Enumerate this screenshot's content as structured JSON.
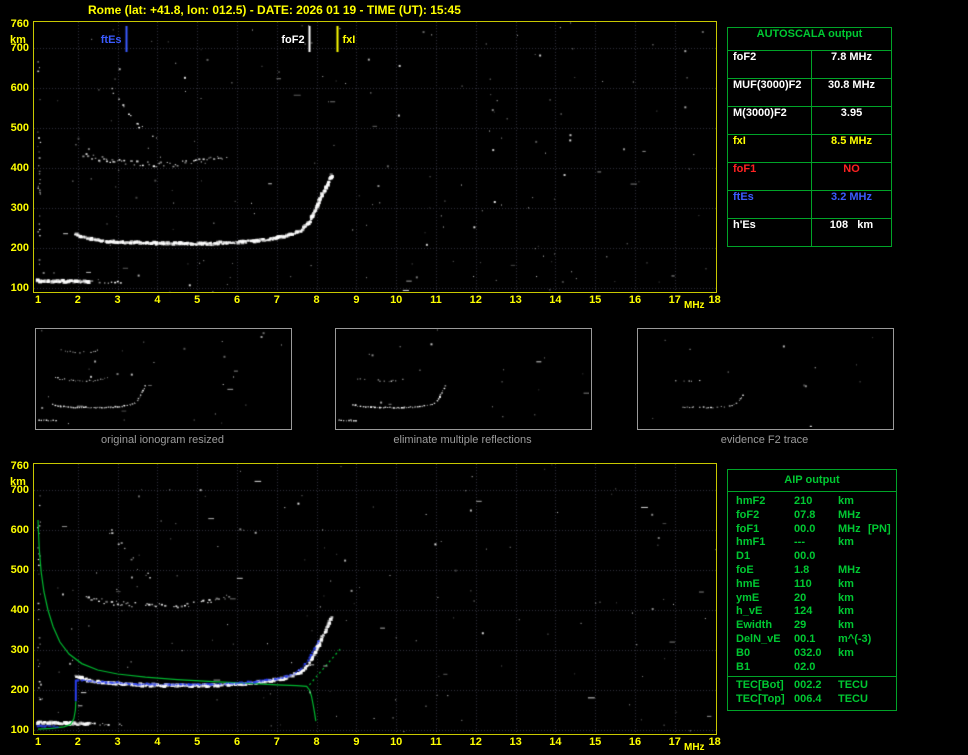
{
  "header": {
    "title": "Rome (lat: +41.8, lon: 012.5) - DATE: 2026 01 19 - TIME (UT): 15:45"
  },
  "colors": {
    "white": "#ffffff",
    "yellow": "#ffff00",
    "red": "#ff2222",
    "blue": "#3b5bff",
    "green": "#00c832",
    "profile_green": "#00b930",
    "restored_blue": "#2a3fee",
    "grid": "#30303c",
    "plot_border": "#c8c800",
    "table_border": "#00a428",
    "caption_gray": "#9c9c9c"
  },
  "autoscala": {
    "title": "AUTOSCALA output",
    "rows": [
      {
        "label": "foF2",
        "value": "7.8 MHz",
        "color": "white"
      },
      {
        "label": "MUF(3000)F2",
        "value": "30.8 MHz",
        "color": "white"
      },
      {
        "label": "M(3000)F2",
        "value": "3.95",
        "color": "white"
      },
      {
        "label": "fxI",
        "value": "8.5 MHz",
        "color": "yellow"
      },
      {
        "label": "foF1",
        "value": "NO",
        "color": "red"
      },
      {
        "label": "ftEs",
        "value": "3.2 MHz",
        "color": "blue"
      },
      {
        "label": "h'Es",
        "value": "108   km",
        "color": "white"
      }
    ]
  },
  "aip": {
    "title": "AIP output",
    "rows": [
      {
        "label": "hmF2",
        "value": "210",
        "unit": "km",
        "note": ""
      },
      {
        "label": "foF2",
        "value": "07.8",
        "unit": "MHz",
        "note": ""
      },
      {
        "label": "foF1",
        "value": "00.0",
        "unit": "MHz",
        "note": "[PN]"
      },
      {
        "label": "hmF1",
        "value": "---",
        "unit": "km",
        "note": ""
      },
      {
        "label": "D1",
        "value": "00.0",
        "unit": "",
        "note": ""
      },
      {
        "label": "foE",
        "value": "1.8",
        "unit": "MHz",
        "note": ""
      },
      {
        "label": "hmE",
        "value": "110",
        "unit": "km",
        "note": ""
      },
      {
        "label": "ymE",
        "value": "20",
        "unit": "km",
        "note": ""
      },
      {
        "label": "h_vE",
        "value": "124",
        "unit": "km",
        "note": ""
      },
      {
        "label": "Ewidth",
        "value": "29",
        "unit": "km",
        "note": ""
      },
      {
        "label": "DelN_vE",
        "value": "00.1",
        "unit": "m^(-3)",
        "note": ""
      },
      {
        "label": "B0",
        "value": "032.0",
        "unit": "km",
        "note": ""
      },
      {
        "label": "B1",
        "value": "02.0",
        "unit": "",
        "note": ""
      }
    ],
    "tec_rows": [
      {
        "label": "TEC[Bot]",
        "value": "002.2",
        "unit": "TECU"
      },
      {
        "label": "TEC[Top]",
        "value": "006.4",
        "unit": "TECU"
      }
    ]
  },
  "chart_data": {
    "type": "scatter",
    "description": "Vertical-incidence ionograms: virtual height (km) vs sounding frequency (MHz)",
    "frequency_axis": {
      "label": "MHz",
      "min": 1,
      "max": 18,
      "ticks": [
        1,
        2,
        3,
        4,
        5,
        6,
        7,
        8,
        9,
        10,
        11,
        12,
        13,
        14,
        15,
        16,
        17,
        18
      ]
    },
    "height_axis": {
      "label": "km",
      "min": 90,
      "max": 770,
      "ticks": [
        760,
        700,
        600,
        500,
        400,
        300,
        200,
        100
      ]
    },
    "trace_library": {
      "es": [
        [
          1.0,
          117
        ],
        [
          1.5,
          116
        ],
        [
          2.0,
          115
        ],
        [
          2.35,
          115
        ]
      ],
      "es_ext": [
        [
          2.35,
          115
        ],
        [
          3.15,
          113
        ]
      ],
      "mainF": [
        [
          1.95,
          233
        ],
        [
          2.3,
          222
        ],
        [
          2.7,
          217
        ],
        [
          3.2,
          213
        ],
        [
          3.8,
          211
        ],
        [
          4.5,
          210
        ],
        [
          5.2,
          210
        ],
        [
          5.8,
          212
        ],
        [
          6.4,
          216
        ],
        [
          6.9,
          222
        ],
        [
          7.3,
          231
        ],
        [
          7.6,
          243
        ],
        [
          7.8,
          262
        ],
        [
          7.95,
          290
        ],
        [
          8.1,
          322
        ],
        [
          8.25,
          353
        ],
        [
          8.4,
          385
        ]
      ],
      "f2_part": [
        [
          3.6,
          212
        ],
        [
          4.5,
          210
        ],
        [
          5.2,
          210
        ],
        [
          5.8,
          212
        ],
        [
          6.4,
          216
        ],
        [
          6.9,
          222
        ],
        [
          7.3,
          231
        ],
        [
          7.6,
          243
        ],
        [
          7.8,
          262
        ],
        [
          7.95,
          290
        ],
        [
          8.1,
          322
        ]
      ],
      "hop2": [
        [
          2.15,
          432
        ],
        [
          2.6,
          422
        ],
        [
          3.1,
          415
        ],
        [
          3.7,
          410
        ],
        [
          4.3,
          408
        ],
        [
          4.9,
          413
        ],
        [
          5.4,
          421
        ],
        [
          5.85,
          434
        ]
      ],
      "hop3": [
        [
          2.4,
          648
        ],
        [
          3.0,
          630
        ],
        [
          3.8,
          620
        ],
        [
          4.6,
          625
        ],
        [
          5.2,
          638
        ]
      ],
      "diag": [
        [
          2.8,
          597
        ],
        [
          3.2,
          547
        ],
        [
          3.6,
          500
        ],
        [
          4.0,
          465
        ]
      ],
      "leftcol": [
        [
          1.03,
          145
        ],
        [
          1.03,
          690
        ]
      ],
      "profile_topside": [
        [
          1.0,
          625
        ],
        [
          1.03,
          555
        ],
        [
          1.08,
          495
        ],
        [
          1.15,
          445
        ],
        [
          1.25,
          400
        ],
        [
          1.38,
          358
        ],
        [
          1.55,
          320
        ],
        [
          1.78,
          290
        ],
        [
          2.1,
          266
        ],
        [
          2.5,
          250
        ],
        [
          3.0,
          240
        ],
        [
          3.7,
          232
        ],
        [
          4.5,
          226
        ],
        [
          5.4,
          221
        ],
        [
          6.2,
          217
        ],
        [
          7.0,
          213
        ],
        [
          7.5,
          211
        ],
        [
          7.75,
          209
        ],
        [
          7.82,
          200
        ],
        [
          7.87,
          185
        ],
        [
          7.91,
          165
        ],
        [
          7.95,
          142
        ],
        [
          7.98,
          122
        ]
      ],
      "profile_e": [
        [
          1.0,
          102
        ],
        [
          1.35,
          104
        ],
        [
          1.65,
          108
        ],
        [
          1.82,
          114
        ],
        [
          1.9,
          128
        ],
        [
          1.94,
          150
        ],
        [
          1.95,
          172
        ]
      ],
      "valley": [
        [
          1.95,
          172
        ],
        [
          1.95,
          226
        ]
      ],
      "muf_dotted": [
        [
          7.82,
          213
        ],
        [
          8.6,
          303
        ]
      ],
      "blue_es": [
        [
          1.0,
          109
        ],
        [
          1.55,
          108
        ]
      ],
      "blue_main": [
        [
          2.0,
          224
        ],
        [
          2.6,
          219
        ],
        [
          3.3,
          215
        ],
        [
          4.1,
          213
        ],
        [
          5.0,
          213
        ],
        [
          5.8,
          215
        ],
        [
          6.5,
          220
        ],
        [
          7.0,
          227
        ],
        [
          7.4,
          238
        ],
        [
          7.65,
          255
        ],
        [
          7.82,
          278
        ],
        [
          7.95,
          302
        ],
        [
          8.08,
          328
        ]
      ]
    },
    "top_ionogram": {
      "seed": 12345,
      "noise": 175,
      "markers": [
        {
          "label": "ftEs",
          "freq_mhz": 3.2,
          "color": "blue",
          "label_side": "left"
        },
        {
          "label": "foF2",
          "freq_mhz": 7.8,
          "color": "white",
          "label_side": "left"
        },
        {
          "label": "fxI",
          "freq_mhz": 8.5,
          "color": "yellow",
          "label_side": "right"
        }
      ],
      "traces": [
        {
          "ref": "es",
          "style": "scatter",
          "color": "white",
          "size": 3,
          "density": 2.4,
          "jy": 1.1,
          "jx": 0.8
        },
        {
          "ref": "es_ext",
          "style": "scatter",
          "color": "white",
          "size": 1.6,
          "density": 0.5,
          "jy": 1,
          "jx": 0.8
        },
        {
          "ref": "mainF",
          "style": "scatter",
          "color": "white",
          "size": 2.8,
          "density": 2.6,
          "jy": 1.2,
          "jx": 0.8
        },
        {
          "ref": "hop2",
          "style": "scatter",
          "color": "white",
          "size": 1.8,
          "density": 0.85,
          "jy": 2.6,
          "jx": 1
        },
        {
          "ref": "diag",
          "style": "scatter",
          "color": "white",
          "size": 1.6,
          "density": 0.4,
          "jy": 3,
          "jx": 1.5
        },
        {
          "ref": "leftcol",
          "style": "scatter",
          "color": "white",
          "size": 1.4,
          "density": 0.28,
          "jy": 0.5,
          "jx": 1.4
        }
      ]
    },
    "bottom_ionogram": {
      "seed": 67890,
      "noise": 150,
      "markers": [],
      "traces": [
        {
          "ref": "es",
          "style": "scatter",
          "color": "white",
          "size": 3,
          "density": 2.4,
          "jy": 1.1,
          "jx": 0.8
        },
        {
          "ref": "es_ext",
          "style": "scatter",
          "color": "white",
          "size": 1.6,
          "density": 0.5,
          "jy": 1,
          "jx": 0.8
        },
        {
          "ref": "mainF",
          "style": "scatter",
          "color": "white",
          "size": 2.8,
          "density": 2.4,
          "jy": 1.2,
          "jx": 0.8
        },
        {
          "ref": "hop2",
          "style": "scatter",
          "color": "white",
          "size": 1.8,
          "density": 0.7,
          "jy": 2.6,
          "jx": 1
        },
        {
          "ref": "diag",
          "style": "scatter",
          "color": "white",
          "size": 1.6,
          "density": 0.35,
          "jy": 3,
          "jx": 1.5
        },
        {
          "ref": "leftcol",
          "style": "scatter",
          "color": "white",
          "size": 1.4,
          "density": 0.2,
          "jy": 0.5,
          "jx": 1.4
        },
        {
          "ref": "profile_topside",
          "style": "line",
          "color": "profile_green",
          "width": 1.2
        },
        {
          "ref": "profile_e",
          "style": "line",
          "color": "profile_green",
          "width": 1.2
        },
        {
          "ref": "muf_dotted",
          "style": "dashed",
          "color": "profile_green",
          "width": 1.2
        },
        {
          "ref": "valley",
          "style": "line",
          "color": "restored_blue",
          "width": 2
        },
        {
          "ref": "blue_es",
          "style": "scatter",
          "color": "restored_blue",
          "size": 2.2,
          "density": 1.8,
          "jy": 0.7,
          "jx": 0.5
        },
        {
          "ref": "blue_main",
          "style": "scatter",
          "color": "restored_blue",
          "size": 2,
          "density": 1.5,
          "jy": 0.8,
          "jx": 0.5
        }
      ]
    },
    "thumbnails": [
      {
        "caption": "original ionogram resized",
        "seed": 101,
        "noise": 30,
        "traces": [
          {
            "ref": "es",
            "style": "scatter",
            "color": "white",
            "size": 1.4,
            "density": 1.6,
            "jy": 0.5,
            "jx": 0.4
          },
          {
            "ref": "mainF",
            "style": "scatter",
            "color": "white",
            "size": 1.4,
            "density": 1.6,
            "jy": 0.5,
            "jx": 0.4
          },
          {
            "ref": "hop2",
            "style": "scatter",
            "color": "white",
            "size": 1.2,
            "density": 0.9,
            "jy": 0.8,
            "jx": 0.5
          },
          {
            "ref": "hop3",
            "style": "scatter",
            "color": "white",
            "size": 1.1,
            "density": 0.5,
            "jy": 0.8,
            "jx": 0.5
          }
        ]
      },
      {
        "caption": "eliminate multiple reflections",
        "seed": 202,
        "noise": 18,
        "traces": [
          {
            "ref": "es",
            "style": "scatter",
            "color": "white",
            "size": 1.4,
            "density": 1.6,
            "jy": 0.5,
            "jx": 0.4
          },
          {
            "ref": "mainF",
            "style": "scatter",
            "color": "white",
            "size": 1.4,
            "density": 1.6,
            "jy": 0.5,
            "jx": 0.4
          },
          {
            "ref": "hop2",
            "style": "scatter",
            "color": "white",
            "size": 1.1,
            "density": 0.3,
            "jy": 0.8,
            "jx": 0.5
          }
        ]
      },
      {
        "caption": "evidence F2 trace",
        "seed": 303,
        "noise": 12,
        "traces": [
          {
            "ref": "f2_part",
            "style": "scatter",
            "color": "white",
            "size": 1.3,
            "density": 0.7,
            "jy": 0.8,
            "jx": 0.5
          },
          {
            "ref": "hop2",
            "style": "scatter",
            "color": "white",
            "size": 1.1,
            "density": 0.2,
            "jy": 0.8,
            "jx": 0.5
          }
        ]
      }
    ]
  }
}
